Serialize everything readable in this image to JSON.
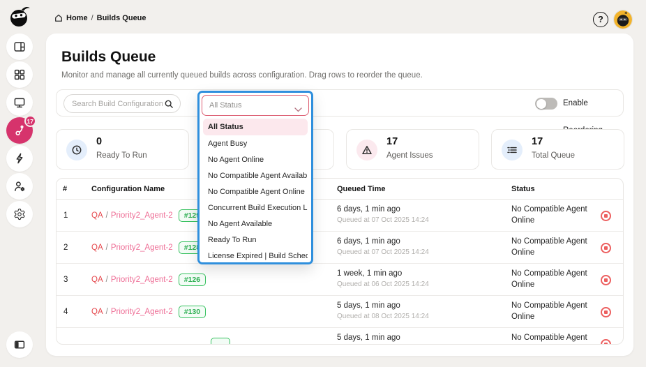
{
  "topbar": {
    "breadcrumb": {
      "home": "Home",
      "separator": "/",
      "current": "Builds Queue"
    },
    "help_label": "?"
  },
  "sidebar": {
    "items": [
      {
        "icon": "layout-icon"
      },
      {
        "icon": "apps-grid-icon"
      },
      {
        "icon": "monitor-icon"
      },
      {
        "icon": "builds-queue-hook-icon",
        "active": true,
        "badge": "17"
      },
      {
        "icon": "lightning-icon"
      },
      {
        "icon": "user-gear-icon"
      },
      {
        "icon": "gear-icon"
      }
    ],
    "bottom_icon": "panel-toggle-icon"
  },
  "page": {
    "title": "Builds Queue",
    "subtitle": "Monitor and manage all currently queued builds across configuration. Drag rows to reorder the queue."
  },
  "toolbar": {
    "search_placeholder": "Search Build Configurations",
    "status_filter_value": "All Status",
    "reorder_label": "Enable Reordering"
  },
  "dropdown": {
    "options": [
      {
        "label": "All Status",
        "selected": true
      },
      {
        "label": "Agent Busy"
      },
      {
        "label": "No Agent Online"
      },
      {
        "label": "No Compatible Agent Available"
      },
      {
        "label": "No Compatible Agent Online"
      },
      {
        "label": "Concurrent Build Execution Li..."
      },
      {
        "label": "No Agent Available"
      },
      {
        "label": "Ready To Run"
      },
      {
        "label": "License Expired | Build Schedu..."
      }
    ]
  },
  "stats": [
    {
      "icon": "clock-icon",
      "value": "0",
      "label": "Ready To Run"
    },
    {
      "icon": "",
      "value": "",
      "label": ""
    },
    {
      "icon": "warning-triangle-icon",
      "value": "17",
      "label": "Agent Issues"
    },
    {
      "icon": "queue-list-icon",
      "value": "17",
      "label": "Total Queue"
    }
  ],
  "table": {
    "columns": [
      "#",
      "Configuration Name",
      "Queued Time",
      "Status"
    ],
    "config_separator": "/",
    "rows": [
      {
        "number": "1",
        "project": "QA",
        "name": "Priority2_Agent-2",
        "build": "#129",
        "time_ago": "6 days, 1 min ago",
        "queued_at": "Queued at 07 Oct 2025 14:24",
        "status": "No Compatible Agent Online"
      },
      {
        "number": "2",
        "project": "QA",
        "name": "Priority2_Agent-2",
        "build": "#128",
        "time_ago": "6 days, 1 min ago",
        "queued_at": "Queued at 07 Oct 2025 14:24",
        "status": "No Compatible Agent Online"
      },
      {
        "number": "3",
        "project": "QA",
        "name": "Priority2_Agent-2",
        "build": "#126",
        "time_ago": "1 week, 1 min ago",
        "queued_at": "Queued at 06 Oct 2025 14:24",
        "status": "No Compatible Agent Online"
      },
      {
        "number": "4",
        "project": "QA",
        "name": "Priority2_Agent-2",
        "build": "#130",
        "time_ago": "5 days, 1 min ago",
        "queued_at": "Queued at 08 Oct 2025 14:24",
        "status": "No Compatible Agent Online"
      },
      {
        "number": "",
        "project": "",
        "name": "",
        "build": "",
        "time_ago": "5 days, 1 min ago",
        "queued_at": "",
        "status": "No Compatible Agent"
      }
    ]
  },
  "colors": {
    "accent": "#d6336c",
    "focus_outline": "#2f8fdd",
    "danger": "#ec5f5f",
    "success": "#35c15e",
    "info": "#4a86e0",
    "select_border": "#dd5f73",
    "selected_option_bg": "#fce8ed",
    "page_bg": "#f2f0ed"
  }
}
